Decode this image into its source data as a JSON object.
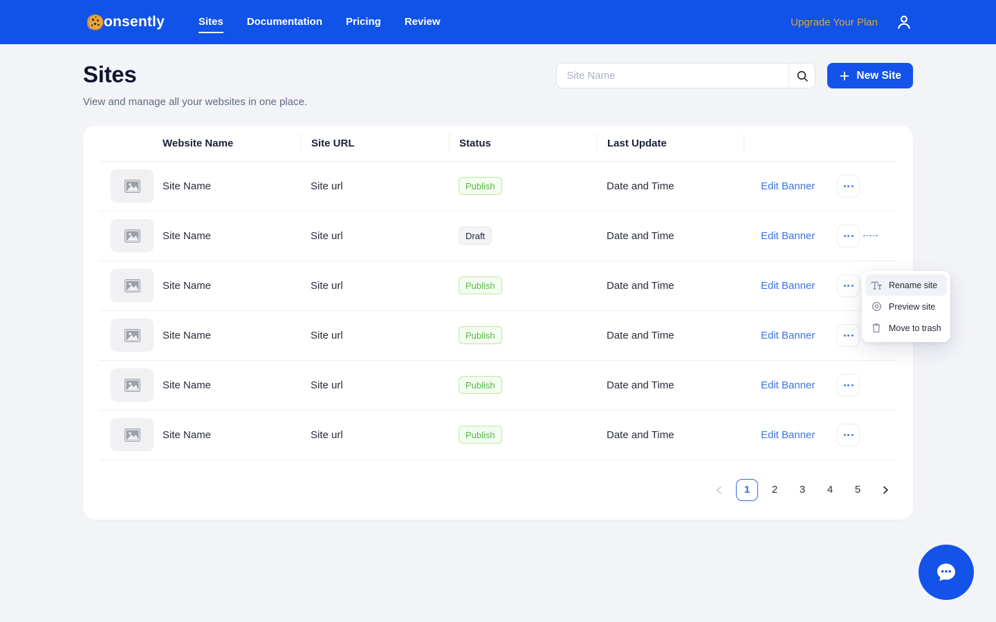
{
  "colors": {
    "header_bg": "#1152e8",
    "primary_blue": "#1353e9",
    "link_blue": "#3b74e3",
    "upgrade_orange": "#dda53f",
    "publish_green": "#56b64b",
    "draft_text": "#23283a",
    "page_bg": "#f3f4f8"
  },
  "header": {
    "logo_text": "onsently",
    "logo_icon": "cookie-icon",
    "nav": [
      {
        "label": "Sites",
        "active": true
      },
      {
        "label": "Documentation",
        "active": false
      },
      {
        "label": "Pricing",
        "active": false
      },
      {
        "label": "Review",
        "active": false
      }
    ],
    "upgrade_label": "Upgrade Your Plan",
    "account_icon": "user-icon"
  },
  "page": {
    "title": "Sites",
    "subtitle": "View and manage all your websites in one place.",
    "search": {
      "placeholder": "Site Name",
      "icon": "search-icon"
    },
    "new_site_button": {
      "label": "New Site",
      "icon": "plus-icon"
    }
  },
  "table": {
    "columns": [
      "Website Name",
      "Site URL",
      "Status",
      "Last Update"
    ],
    "edit_banner_label": "Edit Banner",
    "thumbnail_icon": "image-placeholder-icon",
    "row_menu_icon": "ellipsis-icon",
    "rows": [
      {
        "name": "Site Name",
        "url": "Site url",
        "status": "Publish",
        "status_type": "publish",
        "updated": "Date and Time",
        "menu_open": false
      },
      {
        "name": "Site Name",
        "url": "Site url",
        "status": "Draft",
        "status_type": "draft",
        "updated": "Date and Time",
        "menu_open": true
      },
      {
        "name": "Site Name",
        "url": "Site url",
        "status": "Publish",
        "status_type": "publish",
        "updated": "Date and Time",
        "menu_open": false
      },
      {
        "name": "Site Name",
        "url": "Site url",
        "status": "Publish",
        "status_type": "publish",
        "updated": "Date and Time",
        "menu_open": false
      },
      {
        "name": "Site Name",
        "url": "Site url",
        "status": "Publish",
        "status_type": "publish",
        "updated": "Date and Time",
        "menu_open": false
      },
      {
        "name": "Site Name",
        "url": "Site url",
        "status": "Publish",
        "status_type": "publish",
        "updated": "Date and Time",
        "menu_open": false
      }
    ]
  },
  "context_menu": {
    "items": [
      {
        "label": "Rename site",
        "icon": "text-icon",
        "highlighted": true
      },
      {
        "label": "Preview site",
        "icon": "eye-icon",
        "highlighted": false
      },
      {
        "label": "Move to trash",
        "icon": "trash-icon",
        "highlighted": false
      }
    ]
  },
  "pagination": {
    "prev_icon": "chevron-left-icon",
    "next_icon": "chevron-right-icon",
    "pages": [
      {
        "label": "1",
        "active": true
      },
      {
        "label": "2",
        "active": false
      },
      {
        "label": "3",
        "active": false
      },
      {
        "label": "4",
        "active": false
      },
      {
        "label": "5",
        "active": false
      }
    ]
  },
  "chat_widget": {
    "icon": "chat-icon"
  }
}
